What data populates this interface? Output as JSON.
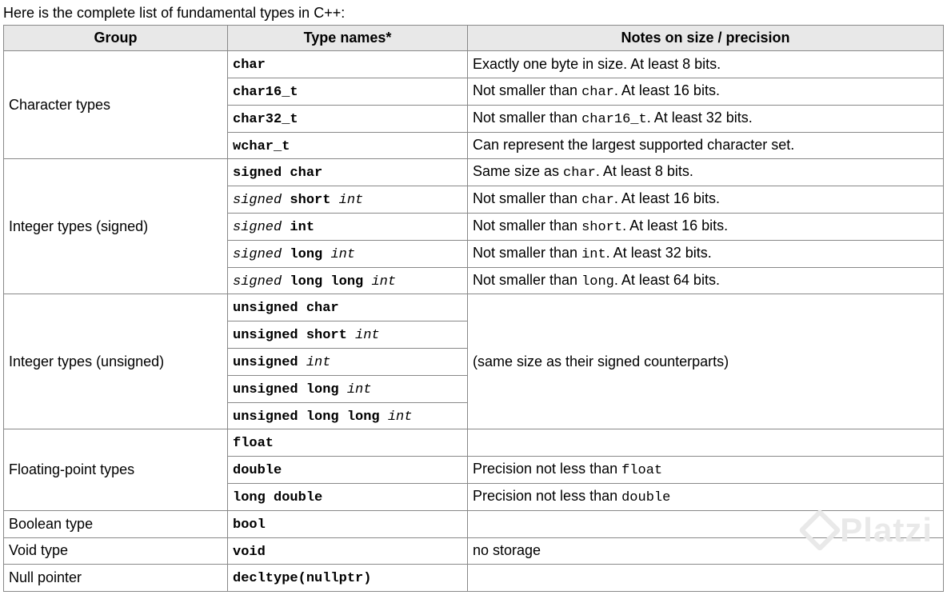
{
  "intro": "Here is the complete list of fundamental types in C++:",
  "headers": {
    "group": "Group",
    "type": "Type names*",
    "notes": "Notes on size / precision"
  },
  "groups": {
    "char": "Character types",
    "int_signed": "Integer types (signed)",
    "int_unsigned": "Integer types (unsigned)",
    "float": "Floating-point types",
    "bool": "Boolean type",
    "void": "Void type",
    "null": "Null pointer"
  },
  "types": {
    "char": [
      {
        "name": [
          {
            "t": "char",
            "b": true
          }
        ],
        "notes": [
          {
            "t": "Exactly one byte in size. At least 8 bits."
          }
        ]
      },
      {
        "name": [
          {
            "t": "char16_t",
            "b": true
          }
        ],
        "notes": [
          {
            "t": "Not smaller than "
          },
          {
            "t": "char",
            "c": true
          },
          {
            "t": ". At least 16 bits."
          }
        ]
      },
      {
        "name": [
          {
            "t": "char32_t",
            "b": true
          }
        ],
        "notes": [
          {
            "t": "Not smaller than "
          },
          {
            "t": "char16_t",
            "c": true
          },
          {
            "t": ". At least 32 bits."
          }
        ]
      },
      {
        "name": [
          {
            "t": "wchar_t",
            "b": true
          }
        ],
        "notes": [
          {
            "t": "Can represent the largest supported character set."
          }
        ]
      }
    ],
    "int_signed": [
      {
        "name": [
          {
            "t": "signed char",
            "b": true
          }
        ],
        "notes": [
          {
            "t": "Same size as "
          },
          {
            "t": "char",
            "c": true
          },
          {
            "t": ". At least 8 bits."
          }
        ]
      },
      {
        "name": [
          {
            "t": "signed",
            "i": true
          },
          {
            "t": " "
          },
          {
            "t": "short",
            "b": true
          },
          {
            "t": " "
          },
          {
            "t": "int",
            "i": true
          }
        ],
        "notes": [
          {
            "t": "Not smaller than "
          },
          {
            "t": "char",
            "c": true
          },
          {
            "t": ". At least 16 bits."
          }
        ]
      },
      {
        "name": [
          {
            "t": "signed",
            "i": true
          },
          {
            "t": " "
          },
          {
            "t": "int",
            "b": true
          }
        ],
        "notes": [
          {
            "t": "Not smaller than "
          },
          {
            "t": "short",
            "c": true
          },
          {
            "t": ". At least 16 bits."
          }
        ]
      },
      {
        "name": [
          {
            "t": "signed",
            "i": true
          },
          {
            "t": " "
          },
          {
            "t": "long",
            "b": true
          },
          {
            "t": " "
          },
          {
            "t": "int",
            "i": true
          }
        ],
        "notes": [
          {
            "t": "Not smaller than "
          },
          {
            "t": "int",
            "c": true
          },
          {
            "t": ". At least 32 bits."
          }
        ]
      },
      {
        "name": [
          {
            "t": "signed",
            "i": true
          },
          {
            "t": " "
          },
          {
            "t": "long long",
            "b": true
          },
          {
            "t": " "
          },
          {
            "t": "int",
            "i": true
          }
        ],
        "notes": [
          {
            "t": "Not smaller than "
          },
          {
            "t": "long",
            "c": true
          },
          {
            "t": ". At least 64 bits."
          }
        ]
      }
    ],
    "int_unsigned": [
      {
        "name": [
          {
            "t": "unsigned char",
            "b": true
          }
        ]
      },
      {
        "name": [
          {
            "t": "unsigned short",
            "b": true
          },
          {
            "t": " "
          },
          {
            "t": "int",
            "i": true
          }
        ]
      },
      {
        "name": [
          {
            "t": "unsigned",
            "b": true
          },
          {
            "t": " "
          },
          {
            "t": "int",
            "i": true
          }
        ]
      },
      {
        "name": [
          {
            "t": "unsigned long",
            "b": true
          },
          {
            "t": " "
          },
          {
            "t": "int",
            "i": true
          }
        ]
      },
      {
        "name": [
          {
            "t": "unsigned long long",
            "b": true
          },
          {
            "t": " "
          },
          {
            "t": "int",
            "i": true
          }
        ]
      }
    ],
    "int_unsigned_note": "(same size as their signed counterparts)",
    "float": [
      {
        "name": [
          {
            "t": "float",
            "b": true
          }
        ],
        "notes": [
          {
            "t": ""
          }
        ]
      },
      {
        "name": [
          {
            "t": "double",
            "b": true
          }
        ],
        "notes": [
          {
            "t": "Precision not less than "
          },
          {
            "t": "float",
            "c": true
          }
        ]
      },
      {
        "name": [
          {
            "t": "long double",
            "b": true
          }
        ],
        "notes": [
          {
            "t": "Precision not less than "
          },
          {
            "t": "double",
            "c": true
          }
        ]
      }
    ],
    "bool": {
      "name": [
        {
          "t": "bool",
          "b": true
        }
      ],
      "notes": [
        {
          "t": ""
        }
      ]
    },
    "void": {
      "name": [
        {
          "t": "void",
          "b": true
        }
      ],
      "notes": [
        {
          "t": "no storage"
        }
      ]
    },
    "null": {
      "name": [
        {
          "t": "decltype(nullptr)",
          "b": true
        }
      ],
      "notes": [
        {
          "t": ""
        }
      ]
    }
  },
  "watermark": "Platzi"
}
